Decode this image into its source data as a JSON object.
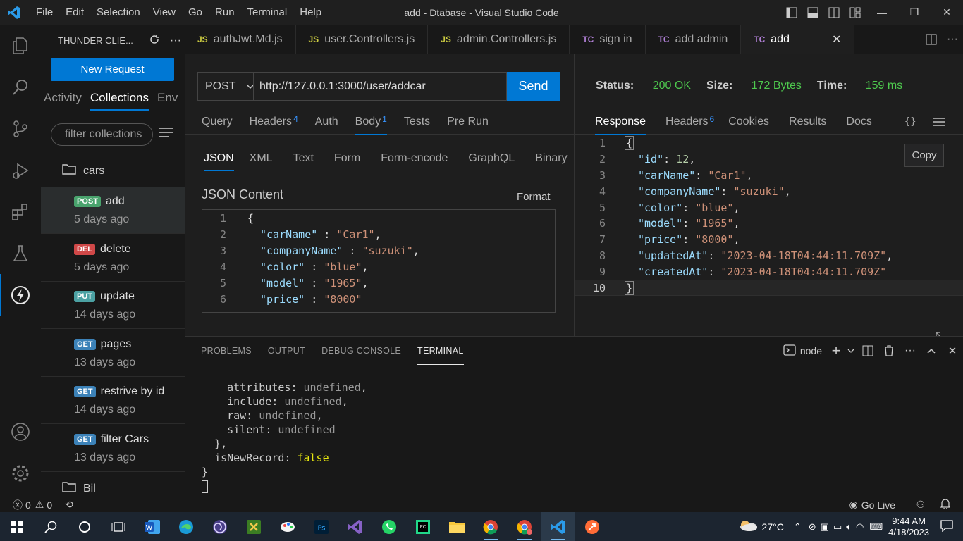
{
  "window": {
    "title": "add - Dtabase - Visual Studio Code",
    "menu": [
      "File",
      "Edit",
      "Selection",
      "View",
      "Go",
      "Run",
      "Terminal",
      "Help"
    ]
  },
  "sidebar": {
    "header": "THUNDER CLIE...",
    "new_request": "New Request",
    "tabs": [
      "Activity",
      "Collections",
      "Env"
    ],
    "filter_placeholder": "filter collections",
    "folder": "cars",
    "requests": [
      {
        "method": "POST",
        "name": "add",
        "time": "5 days ago",
        "color": "#49a36d"
      },
      {
        "method": "DEL",
        "name": "delete",
        "time": "5 days ago",
        "color": "#d04848"
      },
      {
        "method": "PUT",
        "name": "update",
        "time": "14 days ago",
        "color": "#4ca1a3"
      },
      {
        "method": "GET",
        "name": "pages",
        "time": "13 days ago",
        "color": "#3c82b8"
      },
      {
        "method": "GET",
        "name": "restrive by id",
        "time": "14 days ago",
        "color": "#3c82b8"
      },
      {
        "method": "GET",
        "name": "filter Cars",
        "time": "13 days ago",
        "color": "#3c82b8"
      }
    ],
    "partial_folder": "Bil"
  },
  "tabs": [
    {
      "kind": "JS",
      "label": "authJwt.Md.js"
    },
    {
      "kind": "JS",
      "label": "user.Controllers.js"
    },
    {
      "kind": "JS",
      "label": "admin.Controllers.js"
    },
    {
      "kind": "TC",
      "label": "sign in"
    },
    {
      "kind": "TC",
      "label": "add admin"
    },
    {
      "kind": "TC",
      "label": "add"
    }
  ],
  "request": {
    "method": "POST",
    "url": "http://127.0.0.1:3000/user/addcar",
    "send": "Send",
    "tabs": {
      "query": "Query",
      "headers": "Headers",
      "headers_count": "4",
      "auth": "Auth",
      "body": "Body",
      "body_count": "1",
      "tests": "Tests",
      "prerun": "Pre Run"
    },
    "body_tabs": [
      "JSON",
      "XML",
      "Text",
      "Form",
      "Form-encode",
      "GraphQL",
      "Binary"
    ],
    "json_label": "JSON Content",
    "format": "Format",
    "body_lines": [
      {
        "n": "1",
        "text": "{"
      },
      {
        "n": "2",
        "k": "\"carName\"",
        "v": "\"Car1\""
      },
      {
        "n": "3",
        "k": "\"companyName\"",
        "v": "\"suzuki\""
      },
      {
        "n": "4",
        "k": "\"color\"",
        "v": "\"blue\""
      },
      {
        "n": "5",
        "k": "\"model\"",
        "v": "\"1965\""
      },
      {
        "n": "6",
        "k": "\"price\"",
        "v": "\"8000\""
      }
    ]
  },
  "response": {
    "status_label": "Status:",
    "status": "200 OK",
    "size_label": "Size:",
    "size": "172 Bytes",
    "time_label": "Time:",
    "time": "159 ms",
    "tabs": {
      "response": "Response",
      "headers": "Headers",
      "headers_count": "6",
      "cookies": "Cookies",
      "results": "Results",
      "docs": "Docs"
    },
    "copy": "Copy",
    "lines": [
      {
        "n": "1",
        "text": "{"
      },
      {
        "n": "2",
        "k": "\"id\"",
        "v": "12",
        "t": "num"
      },
      {
        "n": "3",
        "k": "\"carName\"",
        "v": "\"Car1\"",
        "t": "str"
      },
      {
        "n": "4",
        "k": "\"companyName\"",
        "v": "\"suzuki\"",
        "t": "str"
      },
      {
        "n": "5",
        "k": "\"color\"",
        "v": "\"blue\"",
        "t": "str"
      },
      {
        "n": "6",
        "k": "\"model\"",
        "v": "\"1965\"",
        "t": "str"
      },
      {
        "n": "7",
        "k": "\"price\"",
        "v": "\"8000\"",
        "t": "str"
      },
      {
        "n": "8",
        "k": "\"updatedAt\"",
        "v": "\"2023-04-18T04:44:11.709Z\"",
        "t": "str"
      },
      {
        "n": "9",
        "k": "\"createdAt\"",
        "v": "\"2023-04-18T04:44:11.709Z\"",
        "t": "str",
        "last": true
      },
      {
        "n": "10",
        "text": "}"
      }
    ]
  },
  "panel": {
    "tabs": [
      "PROBLEMS",
      "OUTPUT",
      "DEBUG CONSOLE",
      "TERMINAL"
    ],
    "shell": "node",
    "terminal": [
      {
        "indent": "    ",
        "k": "attributes",
        "v": "undefined",
        "comma": ","
      },
      {
        "indent": "    ",
        "k": "include",
        "v": "undefined",
        "comma": ","
      },
      {
        "indent": "    ",
        "k": "raw",
        "v": "undefined",
        "comma": ","
      },
      {
        "indent": "    ",
        "k": "silent",
        "v": "undefined",
        "comma": ""
      },
      {
        "indent": "  ",
        "text": "},"
      },
      {
        "indent": "  ",
        "k": "isNewRecord",
        "v": "false",
        "comma": "",
        "bool": true
      },
      {
        "indent": "",
        "text": "}"
      }
    ]
  },
  "status": {
    "errors": "0",
    "warnings": "0",
    "golive": "Go Live"
  },
  "taskbar": {
    "weather": "27°C",
    "time": "9:44 AM",
    "date": "4/18/2023"
  }
}
